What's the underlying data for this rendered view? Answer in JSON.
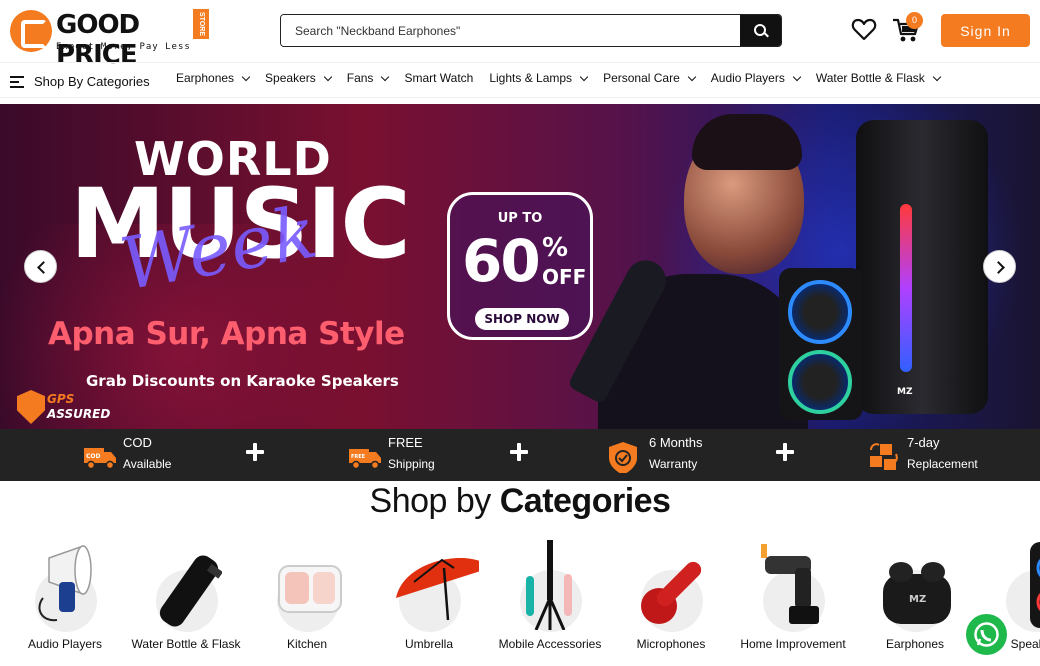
{
  "header": {
    "logo_text": "GOOD PRICE",
    "logo_badge": "STORE",
    "logo_tagline": "Expect More, Pay Less",
    "search_placeholder": "Search \"Neckband Earphones\"",
    "cart_count": "0",
    "signin_label": "Sign In"
  },
  "nav": {
    "categories_label": "Shop By Categories",
    "items": [
      {
        "label": "Earphones",
        "has_dropdown": true
      },
      {
        "label": "Speakers",
        "has_dropdown": true
      },
      {
        "label": "Fans",
        "has_dropdown": true
      },
      {
        "label": "Smart Watch",
        "has_dropdown": false
      },
      {
        "label": "Lights & Lamps",
        "has_dropdown": true
      },
      {
        "label": "Personal Care",
        "has_dropdown": true
      },
      {
        "label": "Audio Players",
        "has_dropdown": true
      },
      {
        "label": "Water Bottle & Flask",
        "has_dropdown": true
      }
    ]
  },
  "banner": {
    "line1": "WORLD",
    "line2": "MUSIC",
    "script": "Week",
    "tagline": "Apna Sur, Apna Style",
    "subline": "Grab Discounts on Karaoke Speakers",
    "badge_top": "GPS",
    "badge_bottom": "ASSURED",
    "offer_upto": "UP TO",
    "offer_value": "60",
    "offer_percent": "%",
    "offer_off": "OFF",
    "offer_cta": "SHOP NOW",
    "speaker_brand": "MZ"
  },
  "features": [
    {
      "title": "COD",
      "subtitle": "Available",
      "icon": "cod-truck-icon",
      "icon_text": "COD"
    },
    {
      "title": "FREE",
      "subtitle": "Shipping",
      "icon": "free-shipping-truck-icon",
      "icon_text": "FREE"
    },
    {
      "title": "6 Months",
      "subtitle": "Warranty",
      "icon": "warranty-shield-icon"
    },
    {
      "title": "7-day",
      "subtitle": "Replacement",
      "icon": "replacement-boxes-icon"
    }
  ],
  "section": {
    "title_light": "Shop by",
    "title_bold": "Categories"
  },
  "categories": [
    {
      "label": "Audio Players",
      "icon": "megaphone-icon"
    },
    {
      "label": "Water Bottle & Flask",
      "icon": "flask-icon"
    },
    {
      "label": "Kitchen",
      "icon": "lunchbox-icon"
    },
    {
      "label": "Umbrella",
      "icon": "umbrella-icon"
    },
    {
      "label": "Mobile Accessories",
      "icon": "tripod-icon"
    },
    {
      "label": "Microphones",
      "icon": "microphone-icon"
    },
    {
      "label": "Home Improvement",
      "icon": "spray-gun-icon"
    },
    {
      "label": "Earphones",
      "icon": "earbuds-case-icon",
      "brand": "MZ"
    },
    {
      "label": "Speakers",
      "icon": "speaker-icon"
    }
  ],
  "colors": {
    "accent": "#f47b20",
    "dark_strip": "#232323",
    "whatsapp": "#1fb84b"
  }
}
